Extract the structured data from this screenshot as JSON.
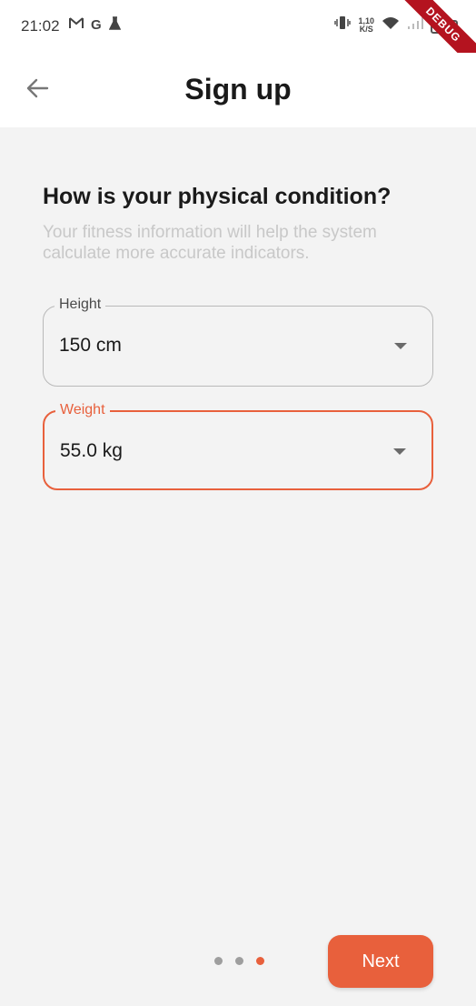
{
  "status_bar": {
    "time": "21:02",
    "left_icons": [
      "gmail-icon",
      "google-icon",
      "flask-icon"
    ],
    "net_speed_value": "1,10",
    "net_speed_unit": "K/S",
    "battery": "59"
  },
  "debug_banner": "DEBUG",
  "header": {
    "title": "Sign up",
    "back_icon": "arrow-left-icon"
  },
  "main": {
    "question": "How is your physical condition?",
    "subtitle": "Your fitness information will help the system calculate more accurate indicators.",
    "height_field": {
      "label": "Height",
      "value": "150 cm"
    },
    "weight_field": {
      "label": "Weight",
      "value": "55.0 kg"
    }
  },
  "footer": {
    "pager": {
      "total": 3,
      "active_index": 2
    },
    "next_label": "Next"
  },
  "colors": {
    "accent": "#e8603c",
    "background": "#f3f3f3",
    "subtitle_text": "#c8c8c8"
  }
}
